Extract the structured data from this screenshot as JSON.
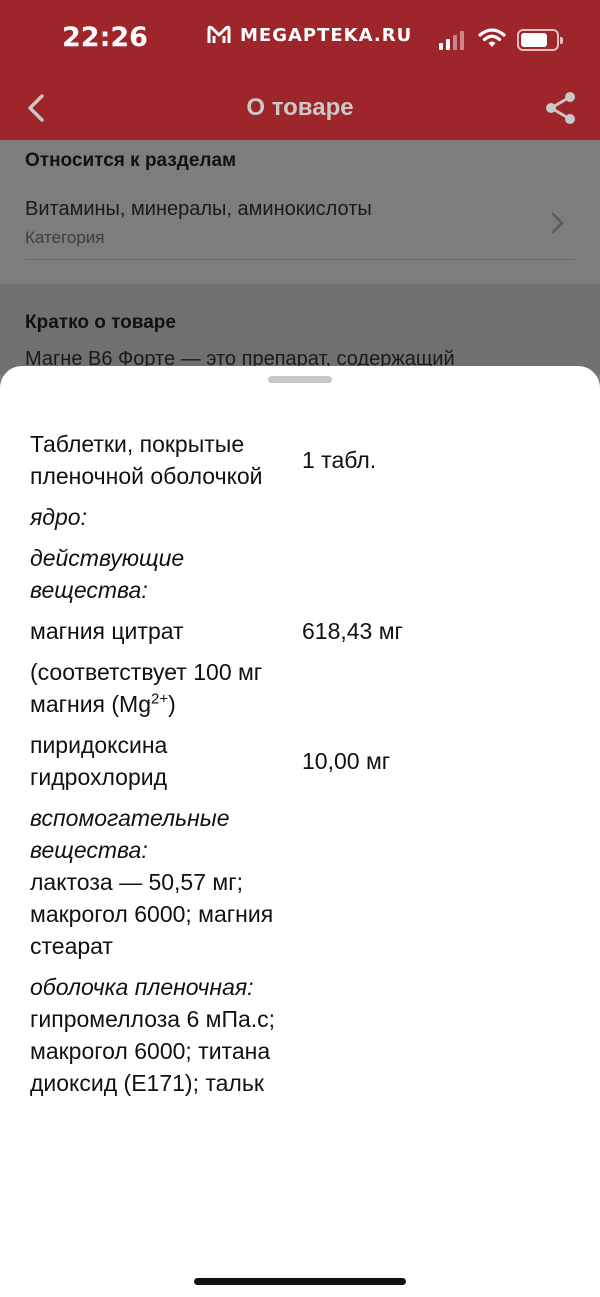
{
  "status_bar": {
    "time": "22:26",
    "brand": "MEGAPTEKA.RU",
    "signal_bars": 4,
    "signal_active": 2,
    "battery_percent": 70
  },
  "nav": {
    "title": "О товаре",
    "back_icon": "chevron-left-icon",
    "share_icon": "share-icon"
  },
  "sections": {
    "categories_heading": "Относится к разделам",
    "category_item": {
      "title": "Витамины, минералы, аминокислоты",
      "subtitle": "Категория"
    },
    "brief_heading": "Кратко о товаре",
    "brief_text": "Магне В6 Форте — это препарат, содержащий"
  },
  "composition": [
    {
      "name": "Таблетки, покрытые пленочной оболочкой",
      "amount": "1 табл."
    },
    {
      "name": "ядро:",
      "italic": true
    },
    {
      "name": "действующие вещества:",
      "italic": true
    },
    {
      "name": "магния цитрат",
      "amount": "618,43 мг"
    },
    {
      "name": "(соответствует 100 мг магния",
      "formula": "(Mg",
      "sup": "2+",
      "close": ")"
    },
    {
      "name": "пиридоксина гидрохлорид",
      "amount": "10,00 мг"
    },
    {
      "name": "вспомогательные вещества:",
      "italic": true
    },
    {
      "name": "лактоза — 50,57 мг; макрогол 6000; магния стеарат"
    },
    {
      "name": "оболочка пленочная:",
      "italic": true
    },
    {
      "name": "гипромеллоза 6 мПа.с; макрогол 6000; титана диоксид (E171); тальк"
    }
  ],
  "colors": {
    "header_red": "#9e252a",
    "overlay_gray": "#7d7d7d",
    "sheet_bg": "#ffffff"
  }
}
